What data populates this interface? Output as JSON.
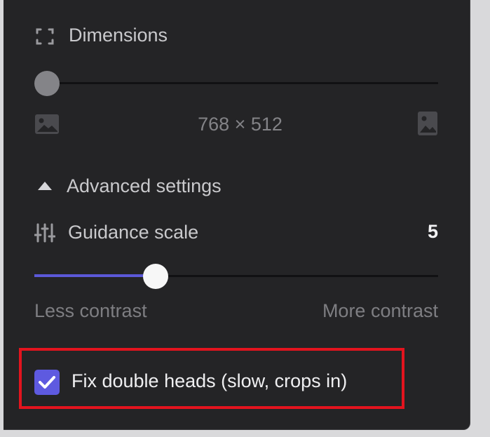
{
  "dimensions": {
    "label": "Dimensions",
    "icon": "dimensions-icon",
    "slider_level": 0,
    "value": "768 × 512",
    "left_icon": "landscape-image-icon",
    "right_icon": "portrait-image-icon"
  },
  "advanced": {
    "label": "Advanced settings",
    "icon": "caret-up-icon"
  },
  "guidance": {
    "label": "Guidance scale",
    "icon": "sliders-icon",
    "value": "5",
    "slider_fraction": 0.3,
    "min_label": "Less contrast",
    "max_label": "More contrast"
  },
  "fix_double_heads": {
    "label": "Fix double heads (slow, crops in)",
    "checked": true,
    "highlight_color": "#e3141e"
  },
  "colors": {
    "accent": "#5e5ae0",
    "panel_bg": "#242426"
  }
}
